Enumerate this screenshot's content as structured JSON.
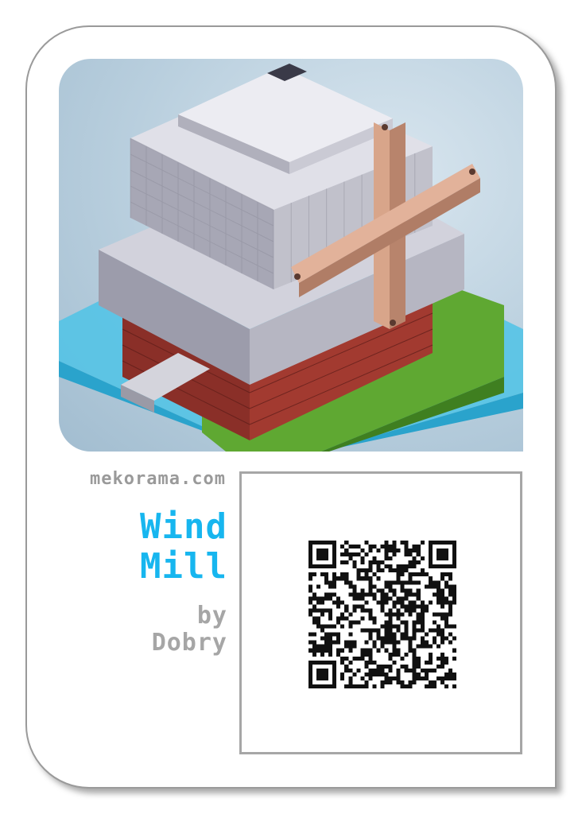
{
  "card": {
    "site": "mekorama.com",
    "title_line1": "Wind",
    "title_line2": "Mill",
    "by_label": "by",
    "author": "Dobry"
  },
  "artwork": {
    "subject": "windmill-level-icon"
  },
  "qr": {
    "icon": "qr-code"
  },
  "colors": {
    "title": "#17b6ef",
    "text_gray": "#9a9a9a",
    "frame_border": "#a6a6a6",
    "water": "#4cc4e8",
    "grass": "#5fa832",
    "brick": "#8a2f28",
    "stone": "#b8b8c4",
    "wood": "#d8a58a"
  }
}
